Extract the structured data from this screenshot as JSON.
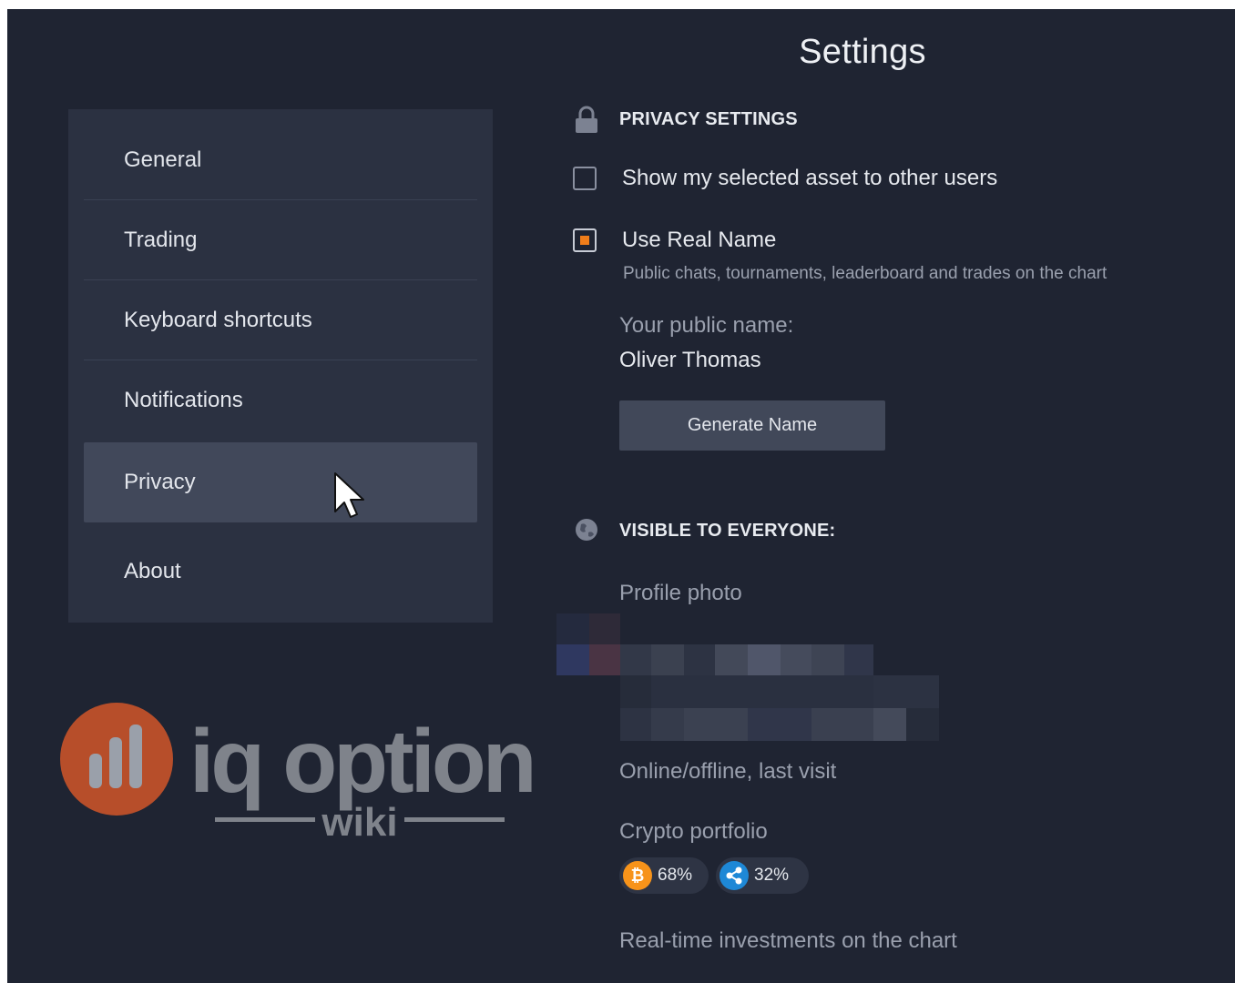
{
  "header": {
    "title": "Settings"
  },
  "sidebar": {
    "items": [
      {
        "label": "General"
      },
      {
        "label": "Trading"
      },
      {
        "label": "Keyboard shortcuts"
      },
      {
        "label": "Notifications"
      },
      {
        "label": "Privacy",
        "active": true
      },
      {
        "label": "About"
      }
    ]
  },
  "privacy": {
    "section_title": "PRIVACY SETTINGS",
    "show_asset": {
      "label": "Show my selected asset to other users",
      "checked": false
    },
    "use_real_name": {
      "label": "Use Real Name",
      "checked": true,
      "description": "Public chats, tournaments, leaderboard and trades on the chart"
    },
    "public_name_label": "Your public name:",
    "public_name_value": "Oliver Thomas",
    "generate_button": "Generate Name"
  },
  "visible": {
    "section_title": "VISIBLE TO EVERYONE:",
    "profile_photo_label": "Profile photo",
    "online_label": "Online/offline, last visit",
    "crypto_label": "Crypto portfolio",
    "crypto": [
      {
        "icon": "bitcoin-icon",
        "symbol": "₿",
        "pct": "68%",
        "color": "#f7931a"
      },
      {
        "icon": "ripple-icon",
        "symbol": "✕",
        "pct": "32%",
        "color": "#1e88d6"
      }
    ],
    "realtime_label": "Real-time investments on the chart"
  },
  "watermark": {
    "brand": "iq option",
    "sub": "wiki",
    "accent": "#d2552a"
  },
  "colors": {
    "accent": "#f07d1a",
    "background": "#1f2432",
    "panel": "#2b3141"
  }
}
